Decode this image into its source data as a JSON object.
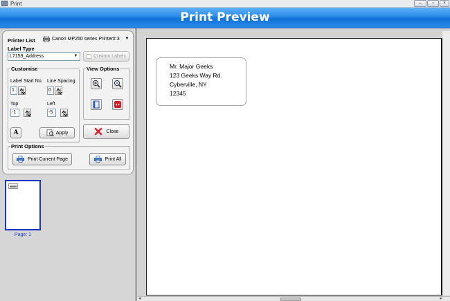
{
  "window": {
    "title": "Print",
    "buttons": [
      "–",
      "▫",
      "×"
    ]
  },
  "banner": {
    "title": "Print Preview"
  },
  "printer_list": {
    "label": "Printer List",
    "value": "Canon MP250 series Printer#:3"
  },
  "label_type": {
    "label": "Label Type",
    "value": "L7159_Address",
    "custom_labels_button": "Custom Labels"
  },
  "customise": {
    "title": "Customise",
    "label_start_no": {
      "label": "Label Start No.",
      "value": "1"
    },
    "line_spacing": {
      "label": "Line Spacing",
      "value": "0"
    },
    "top": {
      "label": "Top",
      "value": "-1"
    },
    "left": {
      "label": "Left",
      "value": "-5"
    },
    "font_button": "A",
    "apply_button": "Apply"
  },
  "view_options": {
    "title": "View Options",
    "close_button": "Close"
  },
  "print_options": {
    "title": "Print Options",
    "print_current_page": "Print Current Page",
    "print_all": "Print All"
  },
  "thumbnail": {
    "label": "Page: 1"
  },
  "preview_label": {
    "lines": [
      "Mr. Major Geeks",
      "123 Geeks Way Rd.",
      "Cyberville, NY",
      "12345"
    ]
  },
  "colors": {
    "banner": "#2a8ae8",
    "thumbnail_border": "#1c33c8",
    "close_icon": "#d9262c"
  },
  "icons": [
    "printer-icon",
    "zoom-in-icon",
    "zoom-out-icon",
    "page-icon",
    "fit-page-icon",
    "close-x-icon",
    "apply-icon"
  ]
}
